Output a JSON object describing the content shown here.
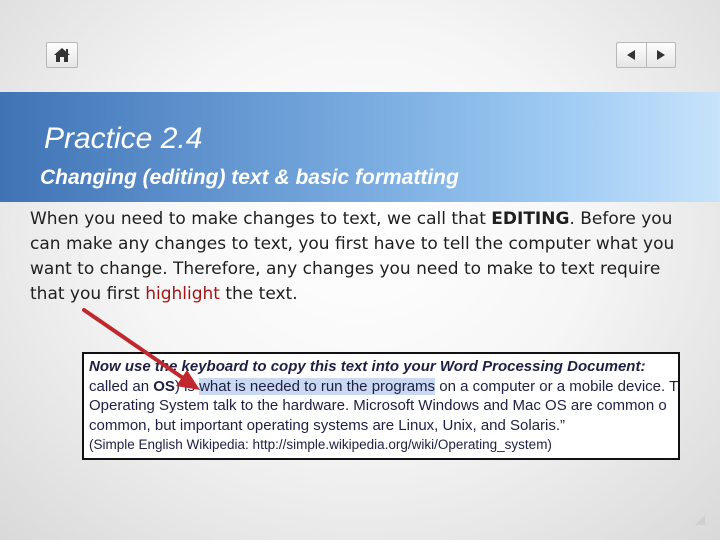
{
  "slide": {
    "title": "Practice 2.4",
    "subtitle": "Changing (editing) text & basic formatting",
    "body": {
      "part1": "When you need to make changes to text, we call that ",
      "em": "EDITING",
      "part2": ". Before you can make any changes to text, you first have to tell the computer what you want to change. Therefore, any changes you need to make to text require that you first ",
      "highlight_word": "highlight",
      "part3": " the text."
    },
    "excerpt": {
      "heading": "Now use the keyboard to copy this text into your Word Processing Document:",
      "line2_pre": "called an ",
      "line2_bold": "OS",
      "line2_mid": ") is ",
      "line2_selected": "what is needed to run the programs",
      "line2_post": " on a computer or a mobile device. T",
      "line3": "Operating System talk to the hardware. Microsoft Windows and Mac OS are common o",
      "line4": "common, but important operating systems are Linux, Unix, and Solaris.”",
      "line5": "(Simple English Wikipedia: http://simple.wikipedia.org/wiki/Operating_system)"
    }
  },
  "nav": {
    "home_icon": "home-icon",
    "prev_icon": "triangle-left-icon",
    "next_icon": "triangle-right-icon"
  },
  "colors": {
    "title_band_start": "#3f73b4",
    "title_band_end": "#c7e3fb",
    "arrow": "#c0282d",
    "highlight_word": "#a31515",
    "selection": "#c9d9f2"
  }
}
